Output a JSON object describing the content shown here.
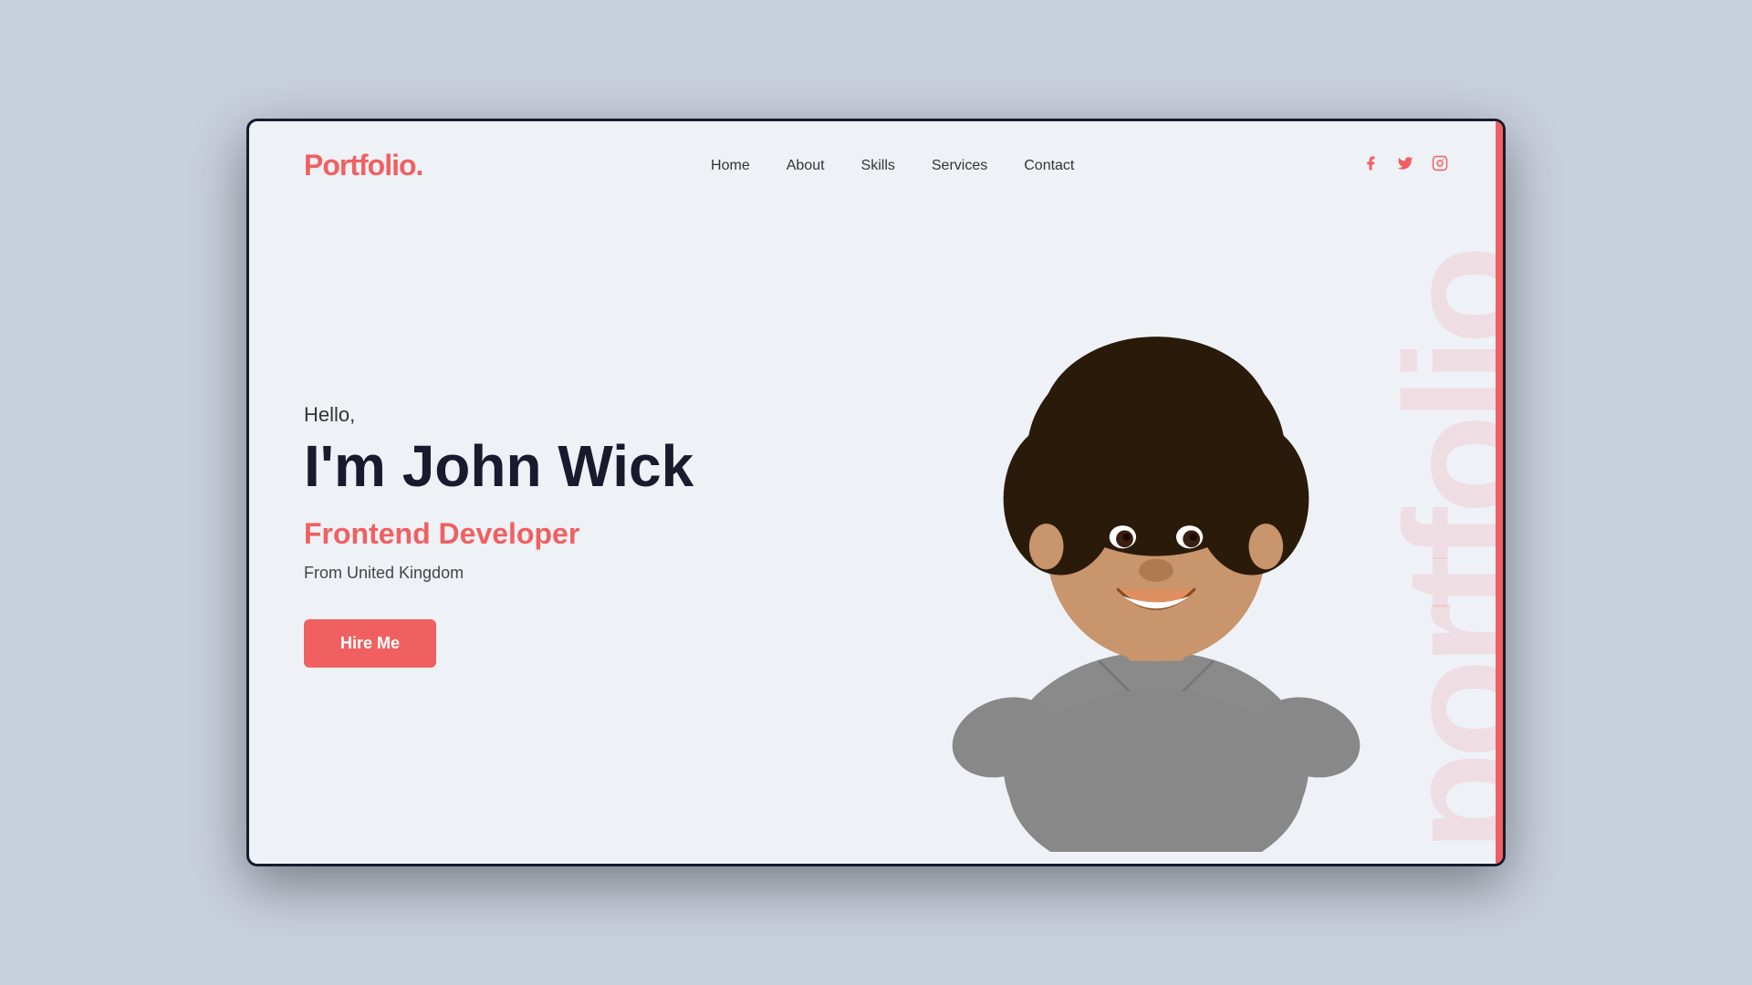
{
  "browser": {
    "border_color": "#1a1a2e"
  },
  "header": {
    "logo": "Portfolio.",
    "nav_items": [
      {
        "label": "Home",
        "active": true
      },
      {
        "label": "About",
        "active": false
      },
      {
        "label": "Skills",
        "active": false
      },
      {
        "label": "Services",
        "active": false
      },
      {
        "label": "Contact",
        "active": false
      }
    ],
    "social": [
      {
        "icon": "f",
        "name": "facebook"
      },
      {
        "icon": "t",
        "name": "twitter"
      },
      {
        "icon": "i",
        "name": "instagram"
      }
    ]
  },
  "hero": {
    "greeting": "Hello,",
    "name": "I'm John Wick",
    "title": "Frontend Developer",
    "location": "From United Kingdom",
    "cta_label": "Hire Me",
    "watermark": "portfolio"
  },
  "colors": {
    "accent": "#f06060",
    "dark": "#1a1a2e",
    "bg": "#eef2f7",
    "text": "#333333"
  }
}
